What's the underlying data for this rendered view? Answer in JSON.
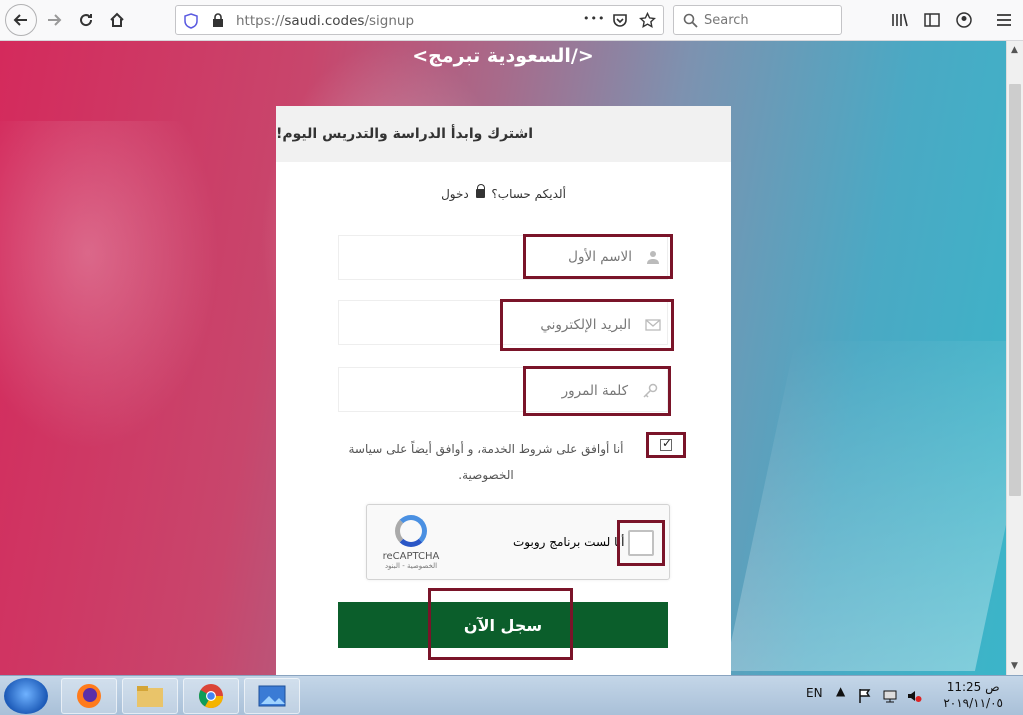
{
  "browser": {
    "url_scheme": "https://",
    "url_host": "saudi.codes",
    "url_path": "/signup",
    "search_placeholder": "Search",
    "menu_dots": "•••"
  },
  "page": {
    "site_title": "</السعودية تبرمج>",
    "card_heading": "اشترك وابدأ الدراسة والتدريس اليوم!",
    "login_prompt": "ألديكم حساب؟",
    "login_link": "دخول",
    "fields": {
      "first_name_placeholder": "الاسم الأول",
      "email_placeholder": "البريد الإلكتروني",
      "password_placeholder": "كلمة المرور"
    },
    "terms_text": "أنا أوافق على شروط الخدمة، و أوافق أيضاً على سياسة الخصوصية.",
    "terms_checked": true,
    "captcha": {
      "label": "أنا لست برنامج روبوت",
      "brand": "reCAPTCHA",
      "links": "الخصوصية - البنود"
    },
    "submit_label": "سجل الآن"
  },
  "taskbar": {
    "language": "EN",
    "time": "11:25 ص",
    "date": "٢٠١٩/١١/٠٥"
  },
  "colors": {
    "highlight_border": "#7a1429",
    "submit_bg": "#0b5e2b"
  }
}
